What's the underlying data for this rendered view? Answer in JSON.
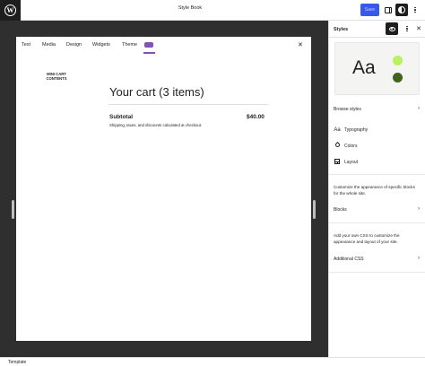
{
  "topbar": {
    "doc_title": "Style Book",
    "save_label": "Save"
  },
  "frame": {
    "tabs": [
      "Text",
      "Media",
      "Design",
      "Widgets",
      "Theme"
    ],
    "woo_tab_icon": "woocommerce-icon",
    "close_icon": "close-icon",
    "mini_cart_line1": "MINI CART",
    "mini_cart_line2": "CONTENTS",
    "cart_title": "Your cart (3 items)",
    "subtotal_label": "Subtotal",
    "subtotal_value": "$40.00",
    "shipping_note": "Shipping, taxes, and discounts calculated at checkout."
  },
  "sidebar": {
    "title": "Styles",
    "preview_text": "Aa",
    "preview_colors": [
      "#b9f25e",
      "#40641e"
    ],
    "browse_styles": "Browse styles",
    "typography": "Typography",
    "colors": "Colors",
    "layout": "Layout",
    "blocks_desc": "Customize the appearance of specific blocks for the whole site.",
    "blocks": "Blocks",
    "css_desc": "Add your own CSS to customize the appearance and layout of your site.",
    "additional_css": "Additional CSS"
  },
  "footer": {
    "label": "Template"
  },
  "colors": {
    "accent": "#3858e9",
    "woo": "#7f54b3",
    "canvas": "#2f2f2f"
  }
}
